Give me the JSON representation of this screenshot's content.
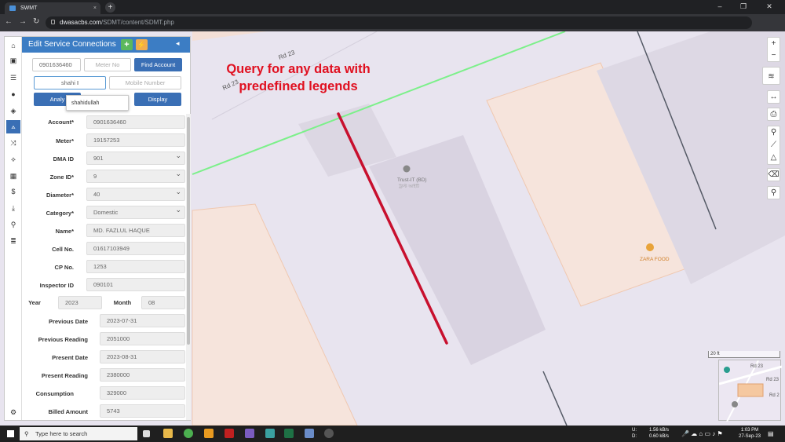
{
  "browser": {
    "tab_title": "SWMT",
    "url_host": "dwasacbs.com",
    "url_path": "/SDMT/content/SDMT.php"
  },
  "panel": {
    "title": "Edit Service Connections",
    "add_label": "+",
    "collapse_label": "◂",
    "search": {
      "account_value": "0901636460",
      "meter_placeholder": "Meter No",
      "find_label": "Find Account",
      "name_value": "shahi",
      "mobile_placeholder": "Mobile Number",
      "analyze_label": "Analy",
      "display_label": "Display",
      "suggestion": "shahidullah"
    },
    "fields": [
      {
        "label": "Account*",
        "value": "0901636460"
      },
      {
        "label": "Meter*",
        "value": "19157253"
      },
      {
        "label": "DMA ID",
        "value": "901"
      },
      {
        "label": "Zone ID*",
        "value": "9"
      },
      {
        "label": "Diameter*",
        "value": "40"
      },
      {
        "label": "Category*",
        "value": "Domestic"
      },
      {
        "label": "Name*",
        "value": "MD. FAZLUL HAQUE"
      },
      {
        "label": "Cell No.",
        "value": "01617103949"
      },
      {
        "label": "CP No.",
        "value": "1253"
      },
      {
        "label": "Inspector ID",
        "value": "090101"
      }
    ],
    "year_label": "Year",
    "year_value": "2023",
    "month_label": "Month",
    "month_value": "08",
    "readings": [
      {
        "label": "Previous Date",
        "value": "2023-07-31"
      },
      {
        "label": "Previous Reading",
        "value": "2051000"
      },
      {
        "label": "Present Date",
        "value": "2023-08-31"
      },
      {
        "label": "Present Reading",
        "value": "2380000"
      },
      {
        "label": "Consumption",
        "value": "329000"
      },
      {
        "label": "Billed Amount",
        "value": "5743"
      }
    ]
  },
  "map": {
    "headline_line1": "Query for any data with",
    "headline_line2": "predefined legends",
    "road_label_1": "Rd 23",
    "road_label_2": "Rd 23",
    "poi_1": "Trust-IT (BD)",
    "poi_1_sub": "ট্রাস্ট আইটি",
    "poi_2": "ZARA FOOD",
    "scale": "20 ft",
    "zoom_in": "+",
    "zoom_out": "−",
    "minimap_labels": [
      "Rd 23",
      "Rd 23",
      "Rd 2"
    ]
  },
  "taskbar": {
    "search_placeholder": "Type here to search",
    "net_up": "1.56 kB/s",
    "net_down": "0.60 kB/s",
    "time": "1:03 PM",
    "date": "27-Sep-23"
  },
  "colors": {
    "panel_header": "#3c7dc4",
    "headline": "#e01020",
    "pipe": "#c8102e",
    "road_green": "#7cf08a"
  }
}
